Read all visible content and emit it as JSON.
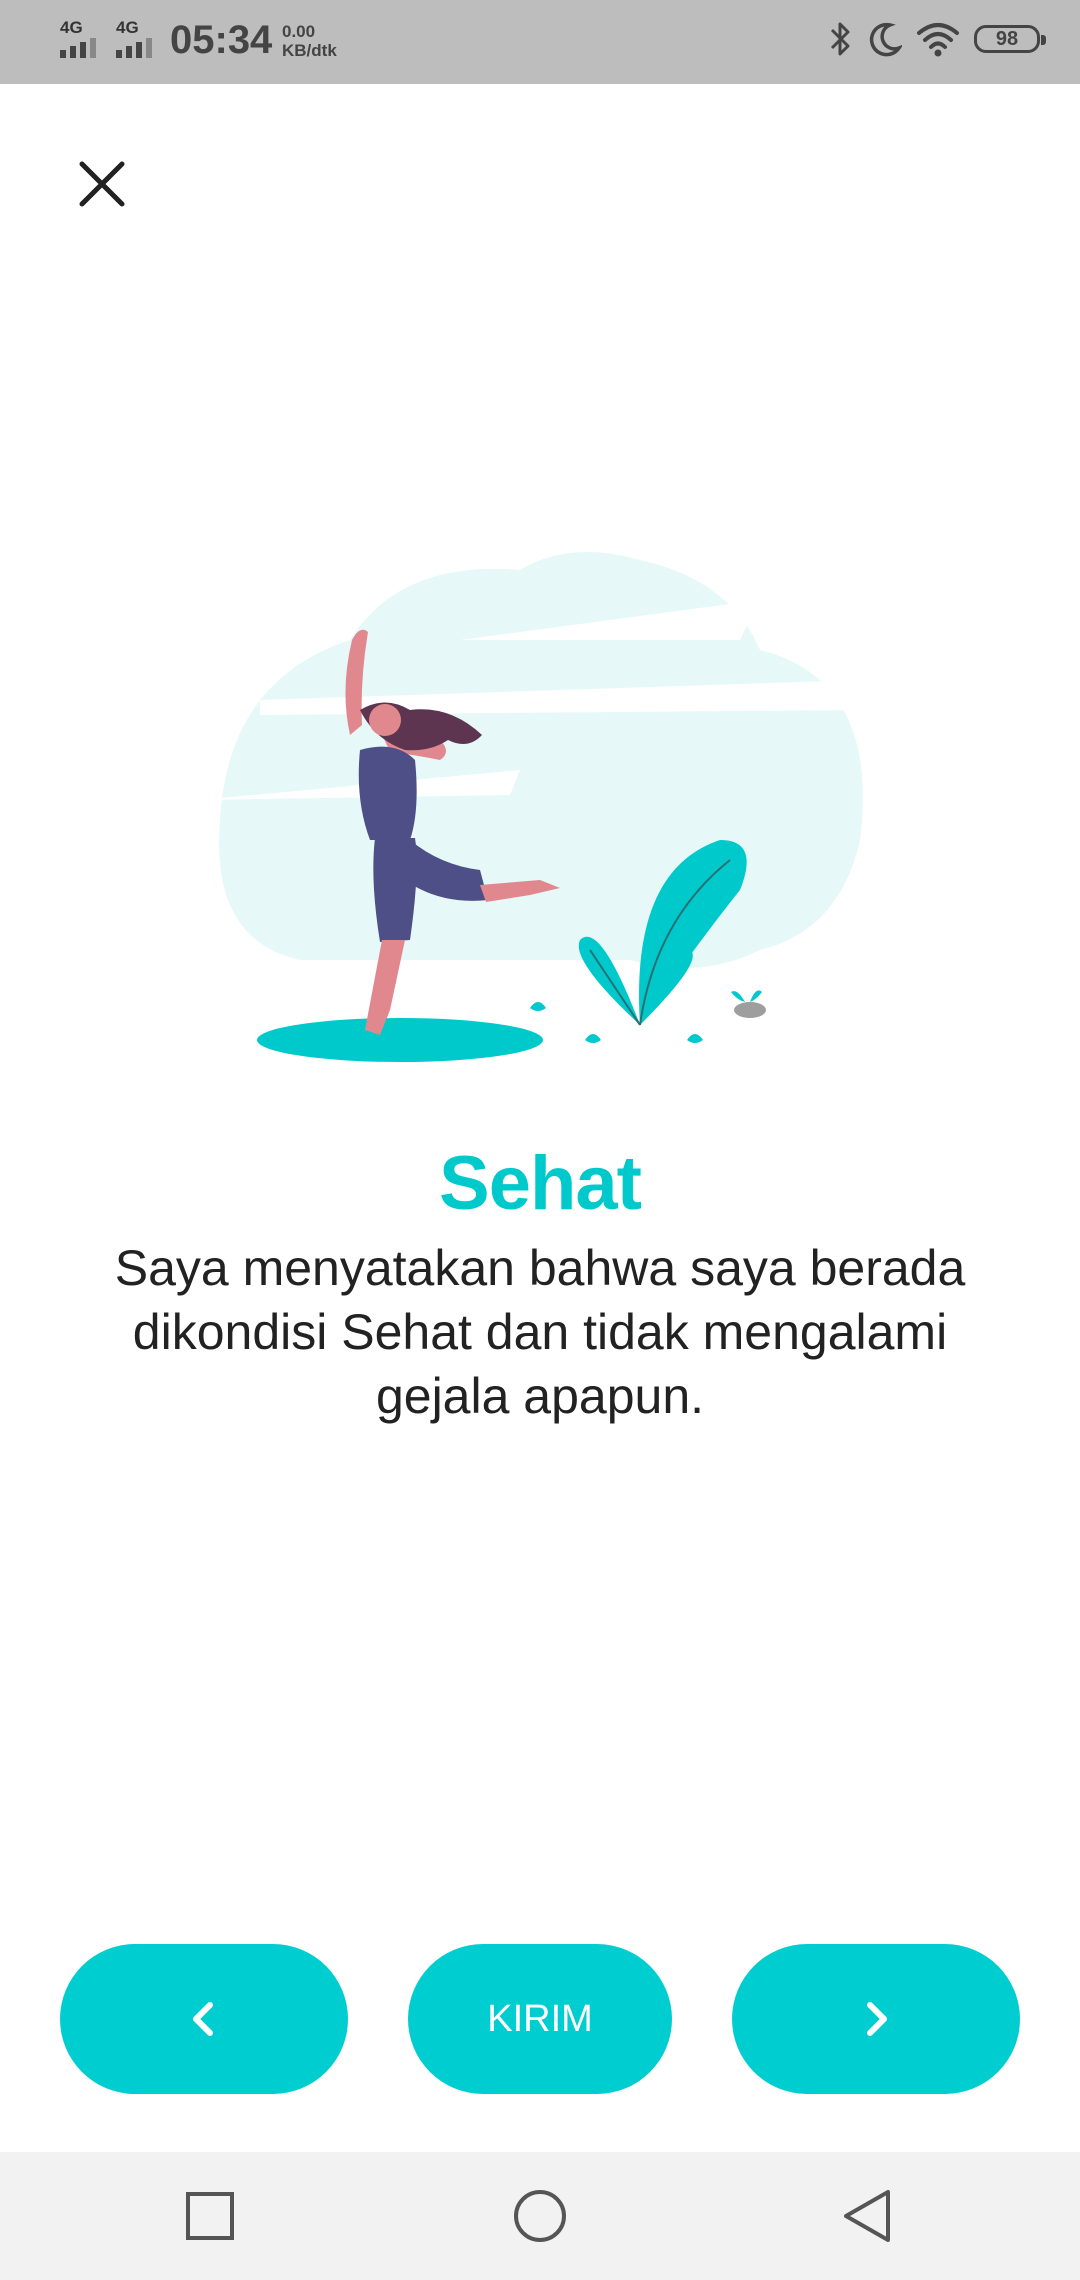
{
  "status_bar": {
    "network1": "4G",
    "network2": "4G",
    "time": "05:34",
    "speed_value": "0.00",
    "speed_unit": "KB/dtk",
    "battery": "98"
  },
  "content": {
    "title": "Sehat",
    "description": "Saya menyatakan bahwa saya berada dikondisi Sehat dan tidak mengalami gejala apapun."
  },
  "buttons": {
    "send_label": "KIRIM"
  },
  "colors": {
    "accent": "#00cdd0",
    "title": "#00c9cc",
    "cloud": "#e6f8f8",
    "text": "#222222"
  },
  "icons": {
    "close": "close-icon",
    "prev": "chevron-left-icon",
    "next": "chevron-right-icon",
    "nav_recent": "square-icon",
    "nav_home": "circle-icon",
    "nav_back": "triangle-back-icon"
  }
}
